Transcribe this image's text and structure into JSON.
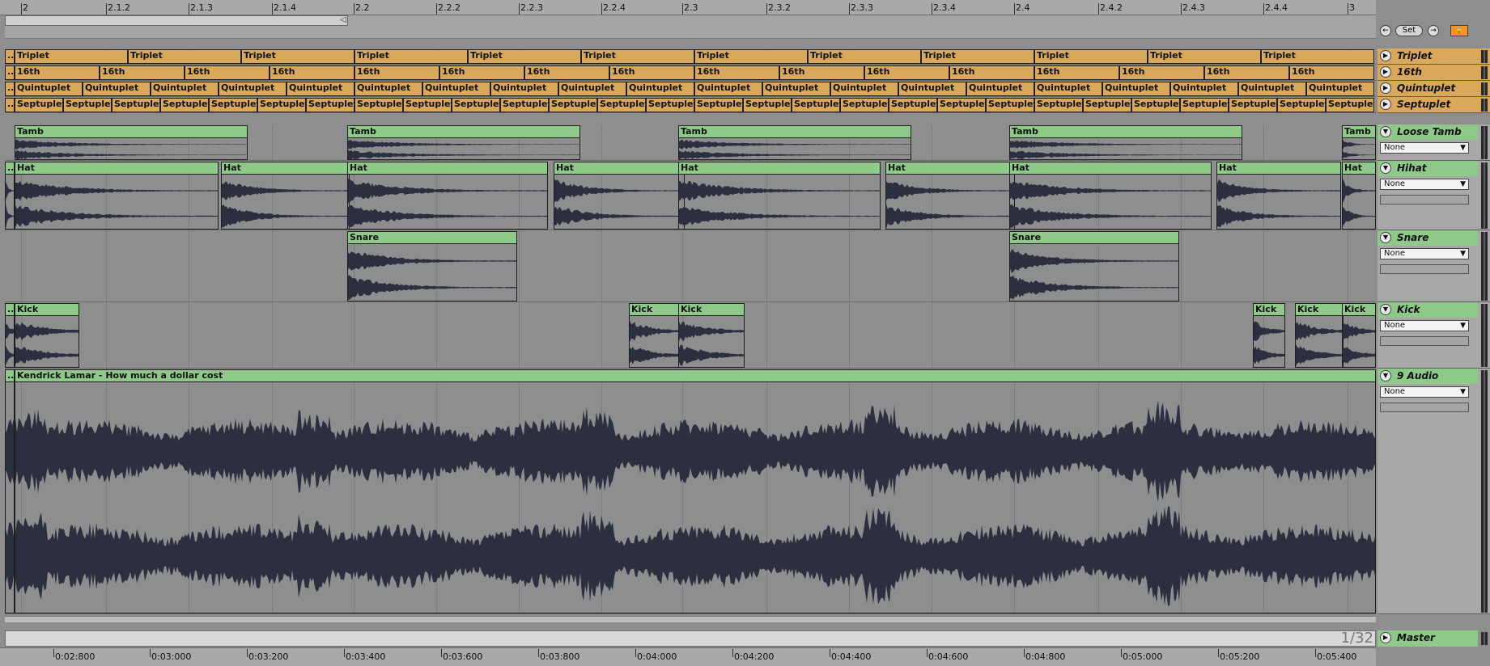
{
  "ruler": {
    "labels": [
      "2",
      "2.1.2",
      "2.1.3",
      "2.1.4",
      "2.2",
      "2.2.2",
      "2.2.3",
      "2.2.4",
      "2.3",
      "2.3.2",
      "2.3.3",
      "2.3.4",
      "2.4",
      "2.4.2",
      "2.4.3",
      "2.4.4",
      "3"
    ]
  },
  "transport": {
    "prev_icon": "left-arrow-icon",
    "prev": "←",
    "set_label": "Set",
    "next_icon": "right-arrow-icon",
    "next": "→",
    "lock_icon": "lock-icon",
    "lock": "🔒"
  },
  "tracks": [
    {
      "name": "Triplet",
      "color": "#d9a85b",
      "clip_label": "Triplet",
      "clips": 13,
      "kind": "orange"
    },
    {
      "name": "16th",
      "color": "#d9a85b",
      "clip_label": "16th",
      "clips": 17,
      "kind": "orange"
    },
    {
      "name": "Quintuplet",
      "color": "#d9a85b",
      "clip_label": "Quintuplet",
      "clips": 21,
      "kind": "orange"
    },
    {
      "name": "Septuplet",
      "color": "#d9a85b",
      "clip_label": "Septuplet",
      "clips": 29,
      "kind": "orange"
    },
    {
      "name": "Loose Tamb",
      "clip_label": "Tamb",
      "io": "None",
      "kind": "green"
    },
    {
      "name": "Hihat",
      "clip_label": "Hat",
      "io": "None",
      "kind": "green"
    },
    {
      "name": "Snare",
      "clip_label": "Snare",
      "io": "None",
      "kind": "green"
    },
    {
      "name": "Kick",
      "clip_label": "Kick",
      "io": "None",
      "kind": "green"
    },
    {
      "name": "9 Audio",
      "clip_label": "Kendrick Lamar - How much a dollar cost",
      "io": "None",
      "kind": "green"
    }
  ],
  "clip_ellipsis": "...",
  "dropdown_arrow": "▼",
  "play_icon": "▶",
  "fold_icon": "▼",
  "master": {
    "name": "Master",
    "zoom": "1/32"
  },
  "timeline": {
    "labels": [
      "0:02:800",
      "0:03:000",
      "0:03:200",
      "0:03:400",
      "0:03:600",
      "0:03:800",
      "0:04:000",
      "0:04:200",
      "0:04:400",
      "0:04:600",
      "0:04:800",
      "0:05:000",
      "0:05:200",
      "0:05:400"
    ]
  }
}
